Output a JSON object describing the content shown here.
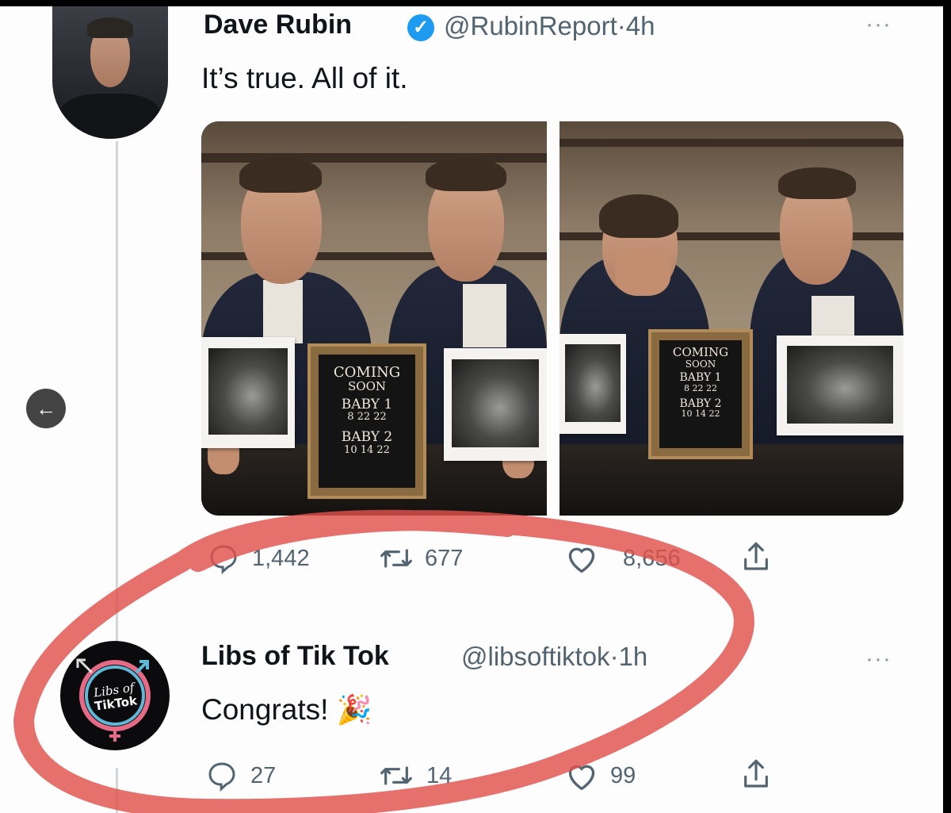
{
  "tweet1": {
    "name": "Dave Rubin",
    "handle": "@RubinReport",
    "sep": "·",
    "time": "4h",
    "more": "···",
    "text": "It’s true. All of it.",
    "photo1": {
      "board": [
        "COMING",
        "SOON",
        "BABY 1",
        "8 22 22",
        "BABY 2",
        "10 14 22"
      ]
    },
    "photo2": {
      "board": [
        "COMING",
        "SOON",
        "BABY 1",
        "8 22 22",
        "BABY 2",
        "10 14 22"
      ]
    },
    "actions": {
      "replies": "1,442",
      "retweets": "677",
      "likes": "8,656"
    }
  },
  "tweet2": {
    "name": "Libs of Tik Tok",
    "handle": "@libsoftiktok",
    "sep": "·",
    "time": "1h",
    "more": "···",
    "text": "Congrats!",
    "emoji": "🎉",
    "avatar_text": [
      "Libs of",
      "TikTok"
    ],
    "actions": {
      "replies": "27",
      "retweets": "14",
      "likes": "99"
    }
  },
  "colors": {
    "accent": "#1d9bf0",
    "annotation": "#e0504a",
    "text": "#0f1419",
    "muted": "#536471"
  },
  "icons": [
    "verified-badge-icon",
    "more-icon",
    "reply-icon",
    "retweet-icon",
    "like-icon",
    "share-icon",
    "back-arrow-icon"
  ]
}
